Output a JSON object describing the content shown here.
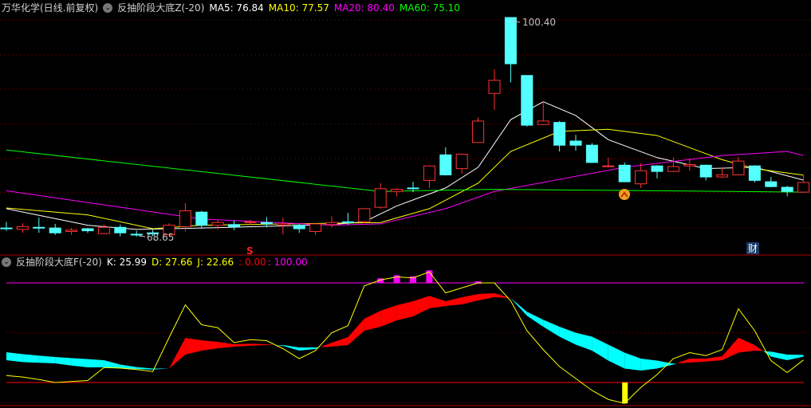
{
  "header": {
    "stock": "万华化学(日线.前复权)",
    "indicator": "反抽阶段大底Z(-20)",
    "ma5": "MA5: 76.84",
    "ma10": "MA10: 77.57",
    "ma20": "MA20: 80.40",
    "ma60": "MA60: 75.10"
  },
  "lower_header": {
    "indicator": "反抽阶段大底F(-20)",
    "k": "K: 25.99",
    "d": "D: 27.66",
    "j": "J: 22.66",
    "low_ref": ": 0.00",
    "high_ref": ": 100.00"
  },
  "annotations": {
    "high_label": "100.40",
    "low_label": "68.65",
    "signal_s": "S",
    "finance_badge": "财"
  },
  "colors": {
    "up": "#ff3232",
    "down": "#54ffff",
    "ma5": "#ffffff",
    "ma10": "#ffff00",
    "ma20": "#ff00ff",
    "ma60": "#00ff00",
    "grid": "#8b0000"
  },
  "chart_data": [
    {
      "type": "candlestick",
      "title": "万华化学(日线.前复权)",
      "ylim": [
        68.65,
        100.4
      ],
      "ohlc": [
        [
          69.9,
          70.8,
          69.5,
          69.9
        ],
        [
          69.7,
          70.6,
          69.2,
          70.1
        ],
        [
          70.0,
          71.4,
          69.2,
          69.9
        ],
        [
          69.9,
          70.5,
          68.9,
          69.2
        ],
        [
          69.4,
          69.9,
          68.9,
          69.6
        ],
        [
          69.8,
          69.9,
          69.2,
          69.5
        ],
        [
          69.1,
          70.4,
          69.0,
          70.0
        ],
        [
          70.0,
          70.4,
          68.7,
          69.2
        ],
        [
          69.0,
          69.5,
          68.65,
          68.9
        ],
        [
          69.2,
          69.7,
          68.7,
          69.2
        ],
        [
          68.9,
          70.6,
          68.8,
          70.3
        ],
        [
          70.1,
          73.5,
          69.4,
          72.4
        ],
        [
          72.2,
          72.4,
          69.8,
          70.3
        ],
        [
          70.3,
          71.0,
          69.7,
          70.7
        ],
        [
          70.4,
          71.0,
          69.6,
          70.1
        ],
        [
          70.7,
          71.1,
          70.4,
          70.8
        ],
        [
          70.7,
          71.5,
          70.0,
          70.5
        ],
        [
          70.3,
          71.4,
          69.0,
          70.5
        ],
        [
          70.3,
          70.5,
          69.2,
          69.8
        ],
        [
          69.4,
          70.6,
          68.9,
          70.5
        ],
        [
          70.4,
          71.6,
          70.0,
          70.7
        ],
        [
          70.8,
          72.1,
          70.4,
          70.7
        ],
        [
          70.8,
          72.7,
          70.6,
          72.7
        ],
        [
          72.9,
          76.4,
          72.7,
          75.6
        ],
        [
          75.2,
          75.7,
          74.5,
          75.5
        ],
        [
          75.7,
          76.6,
          75.1,
          75.6
        ],
        [
          76.8,
          78.9,
          75.7,
          78.9
        ],
        [
          80.5,
          81.6,
          77.5,
          77.6
        ],
        [
          78.5,
          80.6,
          77.8,
          80.6
        ],
        [
          82.3,
          85.9,
          82.3,
          85.4
        ],
        [
          89.4,
          92.9,
          87.0,
          91.3
        ],
        [
          100.4,
          100.4,
          91.0,
          93.7
        ],
        [
          92.0,
          92.0,
          84.6,
          84.8
        ],
        [
          84.9,
          88.3,
          84.8,
          85.4
        ],
        [
          85.2,
          85.4,
          81.0,
          81.9
        ],
        [
          82.5,
          83.4,
          81.1,
          81.9
        ],
        [
          81.9,
          82.2,
          79.3,
          79.4
        ],
        [
          78.8,
          80.1,
          78.7,
          78.9
        ],
        [
          79.0,
          79.4,
          76.6,
          76.6
        ],
        [
          76.3,
          79.3,
          75.7,
          78.2
        ],
        [
          78.9,
          79.0,
          77.1,
          78.1
        ],
        [
          78.1,
          80.1,
          78.0,
          78.8
        ],
        [
          78.9,
          80.0,
          78.2,
          79.1
        ],
        [
          79.0,
          79.1,
          76.8,
          77.3
        ],
        [
          77.3,
          78.6,
          77.1,
          77.6
        ],
        [
          77.6,
          80.2,
          77.6,
          79.6
        ],
        [
          78.9,
          79.0,
          76.5,
          76.8
        ],
        [
          76.6,
          77.3,
          75.8,
          75.9
        ],
        [
          75.8,
          76.0,
          74.5,
          75.2
        ],
        [
          75.1,
          77.6,
          75.0,
          76.5
        ]
      ],
      "ohlc_order": [
        "open",
        "high",
        "low",
        "close"
      ],
      "moving_averages": [
        {
          "name": "MA5",
          "points": [
            [
              0,
              72.7
            ],
            [
              5,
              70.3
            ],
            [
              8,
              69.7
            ],
            [
              12,
              69.9
            ],
            [
              20,
              70.4
            ],
            [
              22,
              70.8
            ],
            [
              24,
              73.1
            ],
            [
              27,
              75.7
            ],
            [
              29,
              78.7
            ],
            [
              31,
              85.6
            ],
            [
              33,
              88.2
            ],
            [
              35,
              86.2
            ],
            [
              37,
              82.7
            ],
            [
              40,
              80.1
            ],
            [
              43,
              78.5
            ],
            [
              46,
              78.7
            ],
            [
              49,
              76.84
            ]
          ]
        },
        {
          "name": "MA10",
          "points": [
            [
              0,
              72.8
            ],
            [
              5,
              71.8
            ],
            [
              9,
              69.8
            ],
            [
              12,
              70.3
            ],
            [
              20,
              70.6
            ],
            [
              23,
              70.7
            ],
            [
              26,
              72.7
            ],
            [
              29,
              76.4
            ],
            [
              31,
              81.0
            ],
            [
              34,
              83.9
            ],
            [
              37,
              84.2
            ],
            [
              40,
              83.3
            ],
            [
              44,
              79.8
            ],
            [
              46,
              78.5
            ],
            [
              49,
              77.57
            ]
          ]
        },
        {
          "name": "MA20",
          "points": [
            [
              0,
              75.3
            ],
            [
              12,
              71.2
            ],
            [
              20,
              70.3
            ],
            [
              23,
              70.5
            ],
            [
              27,
              72.7
            ],
            [
              30,
              75.2
            ],
            [
              38,
              78.7
            ],
            [
              44,
              80.4
            ],
            [
              48,
              81.0
            ],
            [
              49,
              80.4
            ]
          ]
        },
        {
          "name": "MA60",
          "points": [
            [
              0,
              81.2
            ],
            [
              23,
              75.2
            ],
            [
              30,
              75.5
            ],
            [
              40,
              75.3
            ],
            [
              49,
              75.1
            ]
          ]
        }
      ],
      "high_marker_index": 31,
      "low_marker_index": 8,
      "signal_s_index": 15,
      "up_signal_index": 38,
      "finance_badge_index": 46
    },
    {
      "type": "line",
      "title": "反抽阶段大底F(-20)",
      "ylim": [
        -25,
        110
      ],
      "reference_lines": [
        0,
        50,
        100
      ],
      "K": [
        22.4,
        20.5,
        19.8,
        19.2,
        17,
        15.2,
        15.2,
        14,
        13.5,
        13,
        14,
        44.8,
        42.4,
        40.8,
        38.4,
        39,
        38.4,
        36.8,
        32,
        33.6,
        40,
        45.6,
        64,
        72,
        77.6,
        81.6,
        87,
        81.6,
        85.6,
        88.8,
        89.6,
        84.8,
        67,
        56,
        46,
        38,
        32,
        22,
        14,
        12,
        14,
        18,
        24,
        24,
        26.4,
        45,
        37.6,
        26,
        22.4,
        25.99
      ],
      "D": [
        30.4,
        28.5,
        27,
        25.6,
        24.5,
        23.5,
        22.4,
        18,
        15.5,
        14,
        14,
        28,
        32,
        34.4,
        36,
        37,
        37.6,
        37.6,
        35.2,
        35.2,
        36,
        37.6,
        52,
        56,
        62.4,
        66.4,
        74.4,
        76.8,
        78.4,
        82.4,
        85.6,
        84.8,
        71,
        63,
        56,
        50,
        46,
        38,
        30,
        24,
        22,
        19,
        20,
        21,
        22.4,
        30,
        32,
        31,
        28,
        27.66
      ],
      "J": [
        7,
        5.5,
        3,
        0,
        1,
        2,
        15,
        14.5,
        13,
        11,
        45,
        78,
        58,
        55,
        40,
        43,
        42,
        34,
        24,
        32,
        50,
        57,
        97,
        103,
        106,
        105,
        111,
        90,
        95,
        100,
        100,
        82,
        52,
        33,
        16,
        4,
        -8,
        -17,
        -21,
        -5,
        8,
        24,
        30,
        27,
        33,
        74,
        52,
        22,
        10,
        22.66
      ],
      "top_signal_indices": [
        23,
        24,
        25,
        26,
        29
      ],
      "bottom_signal_indices": [
        38
      ]
    }
  ]
}
